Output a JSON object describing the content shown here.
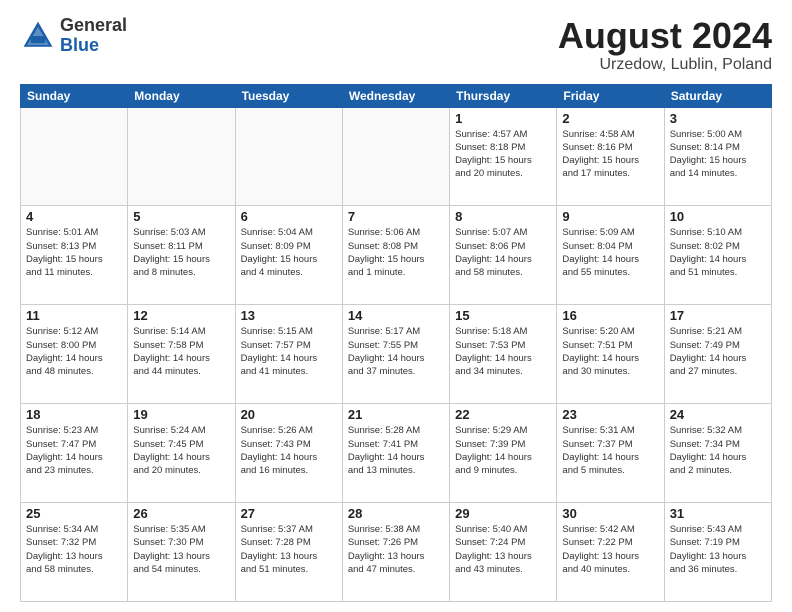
{
  "header": {
    "logo_general": "General",
    "logo_blue": "Blue",
    "title": "August 2024",
    "subtitle": "Urzedow, Lublin, Poland"
  },
  "days_of_week": [
    "Sunday",
    "Monday",
    "Tuesday",
    "Wednesday",
    "Thursday",
    "Friday",
    "Saturday"
  ],
  "weeks": [
    [
      {
        "day": "",
        "info": ""
      },
      {
        "day": "",
        "info": ""
      },
      {
        "day": "",
        "info": ""
      },
      {
        "day": "",
        "info": ""
      },
      {
        "day": "1",
        "info": "Sunrise: 4:57 AM\nSunset: 8:18 PM\nDaylight: 15 hours\nand 20 minutes."
      },
      {
        "day": "2",
        "info": "Sunrise: 4:58 AM\nSunset: 8:16 PM\nDaylight: 15 hours\nand 17 minutes."
      },
      {
        "day": "3",
        "info": "Sunrise: 5:00 AM\nSunset: 8:14 PM\nDaylight: 15 hours\nand 14 minutes."
      }
    ],
    [
      {
        "day": "4",
        "info": "Sunrise: 5:01 AM\nSunset: 8:13 PM\nDaylight: 15 hours\nand 11 minutes."
      },
      {
        "day": "5",
        "info": "Sunrise: 5:03 AM\nSunset: 8:11 PM\nDaylight: 15 hours\nand 8 minutes."
      },
      {
        "day": "6",
        "info": "Sunrise: 5:04 AM\nSunset: 8:09 PM\nDaylight: 15 hours\nand 4 minutes."
      },
      {
        "day": "7",
        "info": "Sunrise: 5:06 AM\nSunset: 8:08 PM\nDaylight: 15 hours\nand 1 minute."
      },
      {
        "day": "8",
        "info": "Sunrise: 5:07 AM\nSunset: 8:06 PM\nDaylight: 14 hours\nand 58 minutes."
      },
      {
        "day": "9",
        "info": "Sunrise: 5:09 AM\nSunset: 8:04 PM\nDaylight: 14 hours\nand 55 minutes."
      },
      {
        "day": "10",
        "info": "Sunrise: 5:10 AM\nSunset: 8:02 PM\nDaylight: 14 hours\nand 51 minutes."
      }
    ],
    [
      {
        "day": "11",
        "info": "Sunrise: 5:12 AM\nSunset: 8:00 PM\nDaylight: 14 hours\nand 48 minutes."
      },
      {
        "day": "12",
        "info": "Sunrise: 5:14 AM\nSunset: 7:58 PM\nDaylight: 14 hours\nand 44 minutes."
      },
      {
        "day": "13",
        "info": "Sunrise: 5:15 AM\nSunset: 7:57 PM\nDaylight: 14 hours\nand 41 minutes."
      },
      {
        "day": "14",
        "info": "Sunrise: 5:17 AM\nSunset: 7:55 PM\nDaylight: 14 hours\nand 37 minutes."
      },
      {
        "day": "15",
        "info": "Sunrise: 5:18 AM\nSunset: 7:53 PM\nDaylight: 14 hours\nand 34 minutes."
      },
      {
        "day": "16",
        "info": "Sunrise: 5:20 AM\nSunset: 7:51 PM\nDaylight: 14 hours\nand 30 minutes."
      },
      {
        "day": "17",
        "info": "Sunrise: 5:21 AM\nSunset: 7:49 PM\nDaylight: 14 hours\nand 27 minutes."
      }
    ],
    [
      {
        "day": "18",
        "info": "Sunrise: 5:23 AM\nSunset: 7:47 PM\nDaylight: 14 hours\nand 23 minutes."
      },
      {
        "day": "19",
        "info": "Sunrise: 5:24 AM\nSunset: 7:45 PM\nDaylight: 14 hours\nand 20 minutes."
      },
      {
        "day": "20",
        "info": "Sunrise: 5:26 AM\nSunset: 7:43 PM\nDaylight: 14 hours\nand 16 minutes."
      },
      {
        "day": "21",
        "info": "Sunrise: 5:28 AM\nSunset: 7:41 PM\nDaylight: 14 hours\nand 13 minutes."
      },
      {
        "day": "22",
        "info": "Sunrise: 5:29 AM\nSunset: 7:39 PM\nDaylight: 14 hours\nand 9 minutes."
      },
      {
        "day": "23",
        "info": "Sunrise: 5:31 AM\nSunset: 7:37 PM\nDaylight: 14 hours\nand 5 minutes."
      },
      {
        "day": "24",
        "info": "Sunrise: 5:32 AM\nSunset: 7:34 PM\nDaylight: 14 hours\nand 2 minutes."
      }
    ],
    [
      {
        "day": "25",
        "info": "Sunrise: 5:34 AM\nSunset: 7:32 PM\nDaylight: 13 hours\nand 58 minutes."
      },
      {
        "day": "26",
        "info": "Sunrise: 5:35 AM\nSunset: 7:30 PM\nDaylight: 13 hours\nand 54 minutes."
      },
      {
        "day": "27",
        "info": "Sunrise: 5:37 AM\nSunset: 7:28 PM\nDaylight: 13 hours\nand 51 minutes."
      },
      {
        "day": "28",
        "info": "Sunrise: 5:38 AM\nSunset: 7:26 PM\nDaylight: 13 hours\nand 47 minutes."
      },
      {
        "day": "29",
        "info": "Sunrise: 5:40 AM\nSunset: 7:24 PM\nDaylight: 13 hours\nand 43 minutes."
      },
      {
        "day": "30",
        "info": "Sunrise: 5:42 AM\nSunset: 7:22 PM\nDaylight: 13 hours\nand 40 minutes."
      },
      {
        "day": "31",
        "info": "Sunrise: 5:43 AM\nSunset: 7:19 PM\nDaylight: 13 hours\nand 36 minutes."
      }
    ]
  ]
}
